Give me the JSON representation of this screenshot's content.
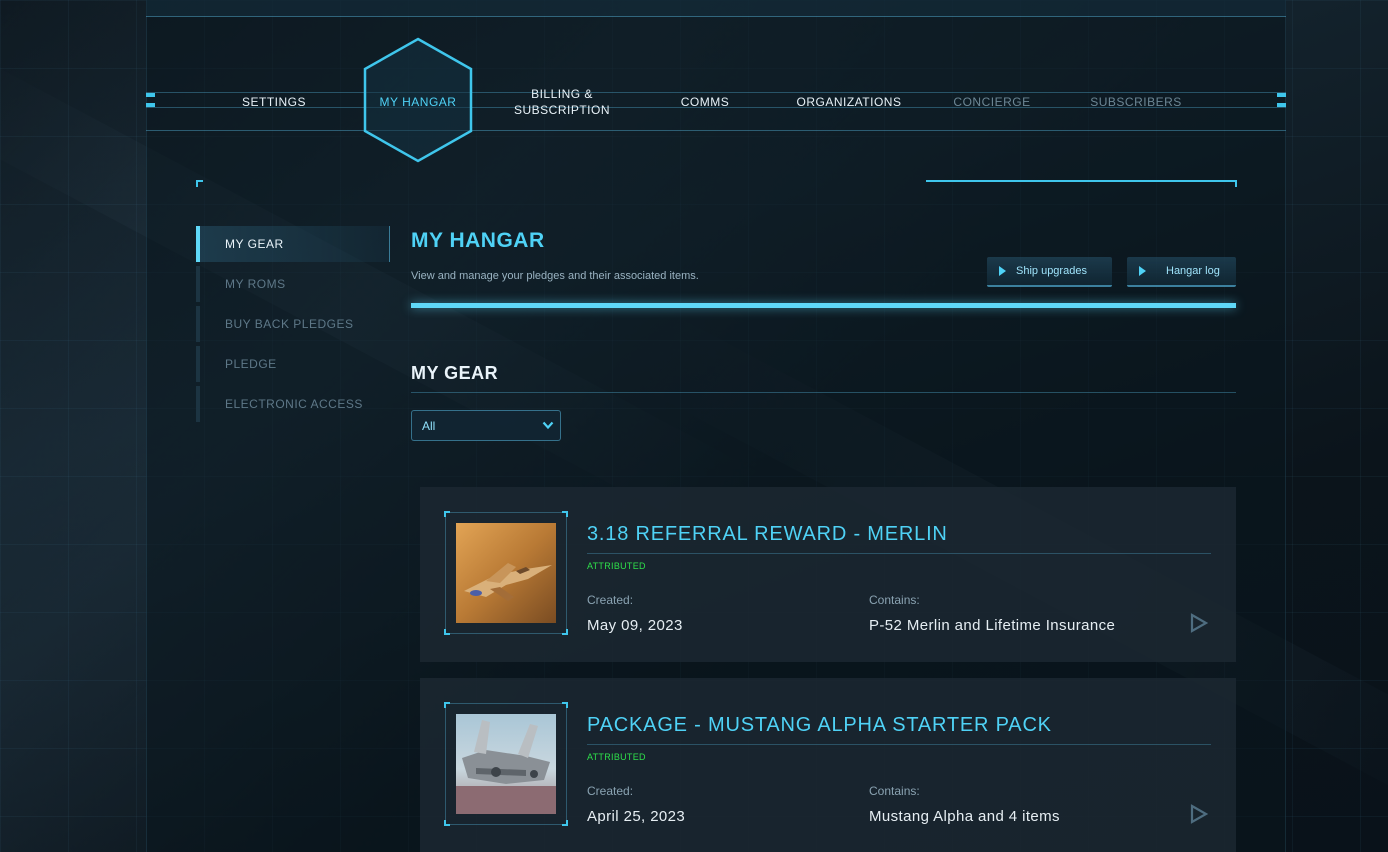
{
  "nav": {
    "items": [
      {
        "label": "SETTINGS",
        "state": "normal"
      },
      {
        "label": "MY HANGAR",
        "state": "active"
      },
      {
        "label": "BILLING & SUBSCRIPTION",
        "state": "normal"
      },
      {
        "label": "COMMS",
        "state": "normal"
      },
      {
        "label": "ORGANIZATIONS",
        "state": "normal"
      },
      {
        "label": "CONCIERGE",
        "state": "dim"
      },
      {
        "label": "SUBSCRIBERS",
        "state": "dim"
      }
    ]
  },
  "sidebar": {
    "items": [
      {
        "label": "MY GEAR",
        "active": true
      },
      {
        "label": "MY ROMS",
        "active": false
      },
      {
        "label": "BUY BACK PLEDGES",
        "active": false
      },
      {
        "label": "PLEDGE",
        "active": false
      },
      {
        "label": "ELECTRONIC ACCESS",
        "active": false
      }
    ]
  },
  "header": {
    "title": "MY HANGAR",
    "subtitle": "View and manage your pledges and their associated items.",
    "buttons": {
      "ship_upgrades": "Ship upgrades",
      "hangar_log": "Hangar log"
    }
  },
  "gear": {
    "section_title": "MY GEAR",
    "filter": {
      "selected": "All"
    },
    "created_label": "Created:",
    "contains_label": "Contains:",
    "items": [
      {
        "title": "3.18 REFERRAL REWARD - MERLIN",
        "status": "ATTRIBUTED",
        "created": "May 09, 2023",
        "contains": "P-52 Merlin and Lifetime Insurance"
      },
      {
        "title": "PACKAGE - MUSTANG ALPHA STARTER PACK",
        "status": "ATTRIBUTED",
        "created": "April 25, 2023",
        "contains": "Mustang Alpha and 4 items"
      }
    ]
  },
  "icons": {
    "card_open": "play-icon",
    "button_marker": "triangle-right-icon",
    "select_toggle": "chevron-down-icon"
  },
  "colors": {
    "accent": "#4fd2f6",
    "status_green": "#2ee04a",
    "background": "#0f1a22"
  }
}
